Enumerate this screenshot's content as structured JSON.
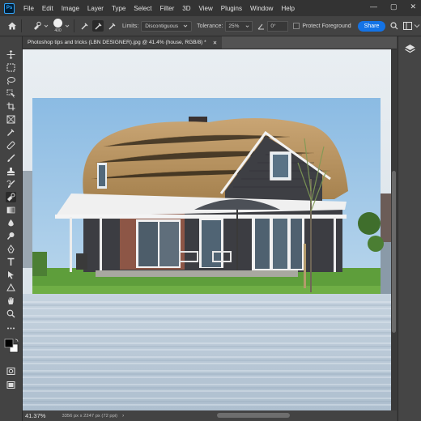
{
  "app": {
    "logo_text": "Ps",
    "menus": [
      "File",
      "Edit",
      "Image",
      "Layer",
      "Type",
      "Select",
      "Filter",
      "3D",
      "View",
      "Plugins",
      "Window",
      "Help"
    ]
  },
  "window_controls": {
    "minimize": "—",
    "maximize": "▢",
    "close": "✕"
  },
  "options": {
    "brush_size": "400",
    "limits_label": "Limits:",
    "limits_value": "Discontiguous",
    "tolerance_label": "Tolerance:",
    "tolerance_value": "25%",
    "angle_value": "0°",
    "protect_foreground_label": "Protect Foreground",
    "protect_foreground_checked": false,
    "share_label": "Share"
  },
  "document": {
    "tab_title": "Photoshop tips and tricks (LBN DESIGNER).jpg @ 41.4% (house, RGB/8) *",
    "close_glyph": "✕"
  },
  "status": {
    "zoom": "41.37%",
    "doc_info": "3356 px x 2247 px (72 ppi)",
    "arrow": "›"
  },
  "tools": [
    "move-tool-icon",
    "marquee-tool-icon",
    "lasso-tool-icon",
    "object-select-tool-icon",
    "crop-tool-icon",
    "frame-tool-icon",
    "eyedropper-tool-icon",
    "healing-brush-tool-icon",
    "brush-tool-icon",
    "clone-stamp-tool-icon",
    "history-brush-tool-icon",
    "background-eraser-tool-icon",
    "gradient-tool-icon",
    "blur-tool-icon",
    "dodge-tool-icon",
    "pen-tool-icon",
    "type-tool-icon",
    "path-select-tool-icon",
    "shape-tool-icon",
    "hand-tool-icon",
    "zoom-tool-icon",
    "more-tools-icon"
  ],
  "colors": {
    "accent": "#1473e6",
    "foreground": "#000000",
    "background": "#ffffff"
  }
}
